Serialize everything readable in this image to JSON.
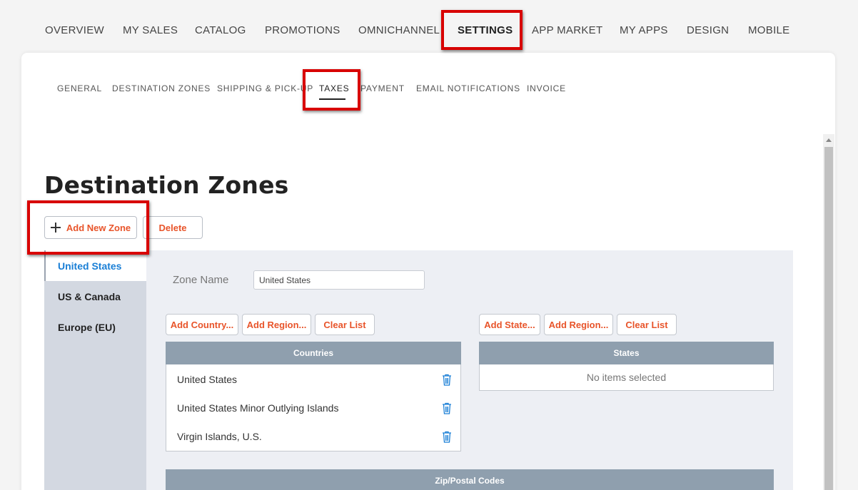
{
  "top_nav": [
    {
      "label": "OVERVIEW",
      "active": false
    },
    {
      "label": "MY SALES",
      "active": false
    },
    {
      "label": "CATALOG",
      "active": false
    },
    {
      "label": "PROMOTIONS",
      "active": false
    },
    {
      "label": "OMNICHANNEL",
      "active": false
    },
    {
      "label": "SETTINGS",
      "active": true
    },
    {
      "label": "APP MARKET",
      "active": false
    },
    {
      "label": "MY APPS",
      "active": false
    },
    {
      "label": "DESIGN",
      "active": false
    },
    {
      "label": "MOBILE",
      "active": false
    }
  ],
  "sub_nav": [
    {
      "label": "GENERAL",
      "active": false
    },
    {
      "label": "DESTINATION ZONES",
      "active": false
    },
    {
      "label": "SHIPPING & PICK-UP",
      "active": false
    },
    {
      "label": "TAXES",
      "active": true
    },
    {
      "label": "PAYMENT",
      "active": false
    },
    {
      "label": "EMAIL NOTIFICATIONS",
      "active": false
    },
    {
      "label": "INVOICE",
      "active": false
    }
  ],
  "page": {
    "title": "Destination Zones",
    "add_zone_label": "Add New Zone",
    "delete_label": "Delete"
  },
  "zones": [
    {
      "label": "United States",
      "active": true
    },
    {
      "label": "US & Canada",
      "active": false
    },
    {
      "label": "Europe (EU)",
      "active": false
    }
  ],
  "editor": {
    "zone_name_label": "Zone Name",
    "zone_name_value": "United States",
    "country_buttons": [
      "Add Country...",
      "Add Region...",
      "Clear List"
    ],
    "state_buttons": [
      "Add State...",
      "Add Region...",
      "Clear List"
    ],
    "countries_header": "Countries",
    "countries": [
      "United States",
      "United States Minor Outlying Islands",
      "Virgin Islands, U.S."
    ],
    "states_header": "States",
    "states_empty": "No items selected",
    "zip_header": "Zip/Postal Codes"
  },
  "colors": {
    "accent": "#e8542a",
    "link": "#1a7fd6",
    "highlight": "#d80000",
    "table_header": "#8f9fae"
  },
  "icons": {
    "add": "plus-icon",
    "remove": "trash-icon",
    "scroll": "chevron-up-icon"
  }
}
